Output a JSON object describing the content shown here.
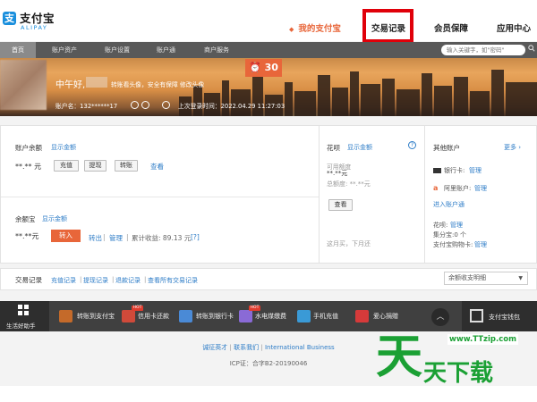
{
  "header": {
    "logo_mark": "支",
    "logo_cn": "支付宝",
    "logo_en": "ALIPAY",
    "nav": [
      "我的支付宝",
      "交易记录",
      "会员保障",
      "应用中心"
    ],
    "highlighted": "交易记录"
  },
  "subnav": {
    "items": [
      "首页",
      "账户资产",
      "账户设置",
      "账户通",
      "商户服务"
    ],
    "search_placeholder": "输入关键字，如\"密码\""
  },
  "banner": {
    "greeting": "中午好,",
    "greeting_sub": "转账看头像，安全有保障 修改头像",
    "account": "账户名：132******17",
    "last_login": "上次登录时间：2022.04.29 11:27:03",
    "alarm_value": "30"
  },
  "balance": {
    "title": "账户余额",
    "show_link": "显示金额",
    "value": "**.** 元",
    "buttons": [
      "充值",
      "提现",
      "转账"
    ],
    "view_link": "查看"
  },
  "yuebao": {
    "title": "余额宝",
    "show_link": "显示金额",
    "value": "**.**元",
    "transfer_in": "转入",
    "transfer_out": "转出",
    "manage": "管理",
    "earnings": "累计收益: 89.13 元",
    "earnings_tag": "[?]"
  },
  "huabei": {
    "title": "花呗",
    "show_link": "显示金额",
    "available_label": "可用额度",
    "available_value": "**.**元",
    "total_label": "总额度: **.**元",
    "view_btn": "查看",
    "note": "这月买，下月还"
  },
  "other": {
    "title": "其他账户",
    "more": "更多",
    "bank_card": "银行卡:",
    "bank_manage": "管理",
    "ali_account": "阿里账户:",
    "ali_manage": "管理",
    "enter_acct": "进入账户通",
    "huabei_label": "花呗:",
    "huabei_manage": "管理",
    "jifen": "集分宝:0 个",
    "shopping_card": "支付宝购物卡:",
    "shopping_manage": "管理"
  },
  "transactions": {
    "title": "交易记录",
    "links": [
      "充值记录",
      "提现记录",
      "退款记录",
      "查看所有交易记录"
    ],
    "select_value": "余额收支明细"
  },
  "dock": {
    "first": "生活好助手",
    "items": [
      "转账到支付宝",
      "信用卡还款",
      "转账到银行卡",
      "水电煤缴费",
      "手机充值",
      "爱心捐赠"
    ],
    "hot": "HOT",
    "wallet": "支付宝钱包"
  },
  "footer": {
    "links": [
      "诚征英才",
      "联系我们",
      "International Business"
    ],
    "sep": "|",
    "icp": "ICP证：合字B2-20190046"
  },
  "watermark": {
    "big": "天",
    "url": "www.TTzip.com",
    "cn": "天下载"
  },
  "colors": {
    "accent": "#e8663a",
    "link": "#2d7cc7",
    "brand": "#1a8fdd",
    "highlight_box": "#e0000a"
  }
}
